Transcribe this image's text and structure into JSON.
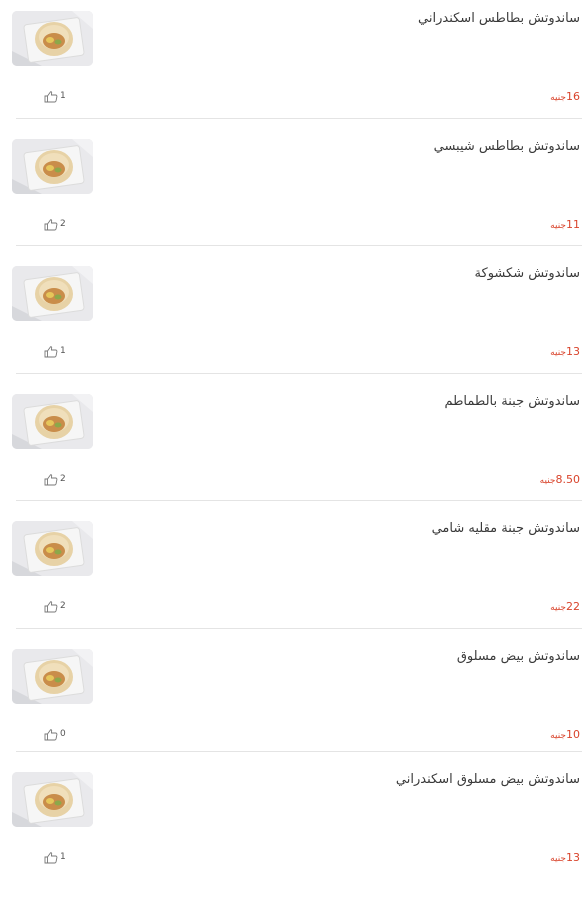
{
  "menu": {
    "currency": "جنيه",
    "items": [
      {
        "name": "ساندوتش بطاطس اسكندراني",
        "price": "16",
        "likes": "1",
        "photo": "fries-in-pita"
      },
      {
        "name": "ساندوتش بطاطس شيبسي",
        "price": "11",
        "likes": "2",
        "photo": "chips-in-pita"
      },
      {
        "name": "ساندوتش شكشوكة",
        "price": "13",
        "likes": "1",
        "photo": "shakshuka-in-pita"
      },
      {
        "name": "ساندوتش جبنة بالطماطم",
        "price": "8.50",
        "likes": "2",
        "photo": "cheese-tomato-pita"
      },
      {
        "name": "ساندوتش جبنة مقليه شامي",
        "price": "22",
        "likes": "2",
        "photo": "fried-cheese-pita"
      },
      {
        "name": "ساندوتش بيض مسلوق",
        "price": "10",
        "likes": "0",
        "photo": "boiled-egg-pita"
      },
      {
        "name": "ساندوتش بيض مسلوق اسكندراني",
        "price": "13",
        "likes": "1",
        "photo": "boiled-egg-alex-pita"
      }
    ]
  }
}
